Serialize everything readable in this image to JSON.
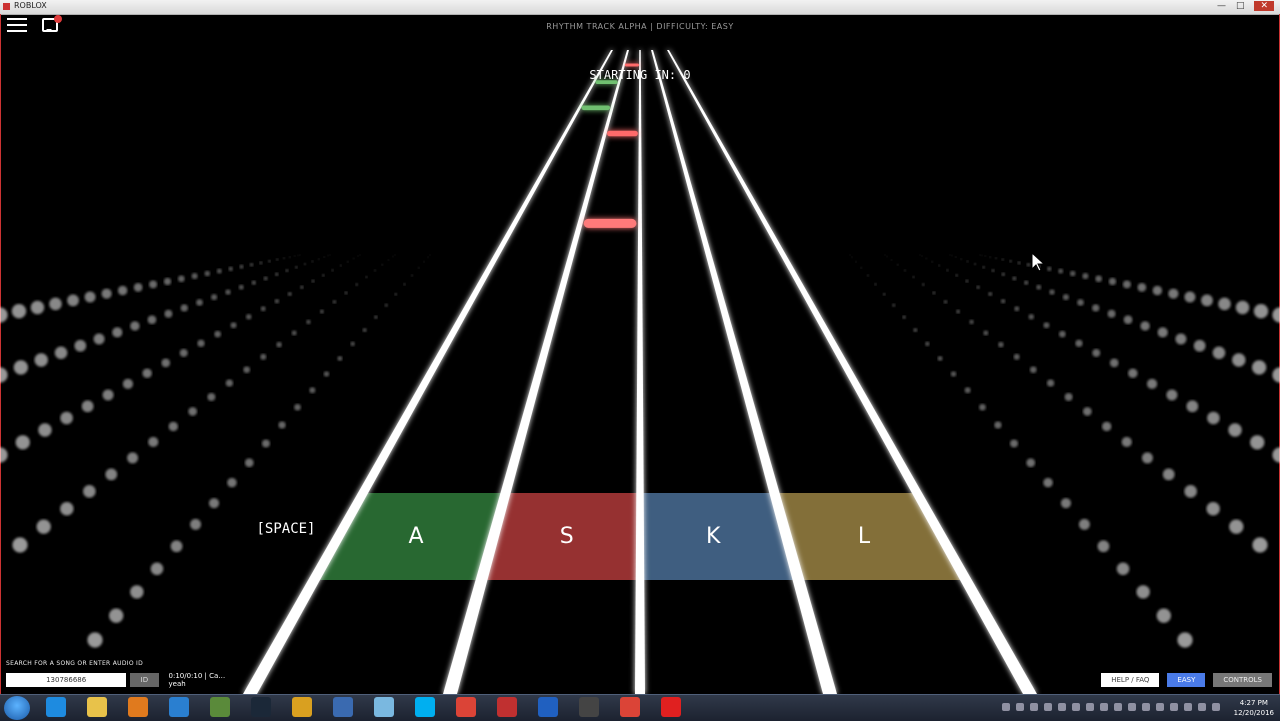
{
  "window": {
    "title": "ROBLOX"
  },
  "header": {
    "text": "RHYTHM TRACK ALPHA | DIFFICULTY: EASY"
  },
  "countdown": {
    "text": "STARTING IN: 0"
  },
  "lanes": [
    {
      "key": "A",
      "color": "#2f7a3a"
    },
    {
      "key": "S",
      "color": "#b03a3a"
    },
    {
      "key": "K",
      "color": "#4a6f96"
    },
    {
      "key": "L",
      "color": "#9a8243"
    }
  ],
  "space_label": "[SPACE]",
  "notes": [
    {
      "lane": 0,
      "depth": 0.04,
      "color": "#6fc06f"
    },
    {
      "lane": 0,
      "depth": 0.1,
      "color": "#6fc06f"
    },
    {
      "lane": 1,
      "depth": 0.16,
      "color": "#ff6a6a"
    },
    {
      "lane": 1,
      "depth": 0.37,
      "color": "#ff7a7a"
    },
    {
      "lane": 1,
      "depth": 0.0,
      "color": "#ff6a6a"
    }
  ],
  "search": {
    "label": "SEARCH FOR A SONG OR ENTER AUDIO ID",
    "value": "130786686",
    "id_button": "ID",
    "time": "0:10/0:10 | Ca… yeah"
  },
  "buttons": {
    "help": "HELP / FAQ",
    "difficulty": "EASY",
    "controls": "CONTROLS"
  },
  "clock": {
    "time": "4:27 PM",
    "date": "12/20/2016"
  },
  "colors": {
    "accent": "#4a7be8",
    "window_border": "#cc3333"
  }
}
